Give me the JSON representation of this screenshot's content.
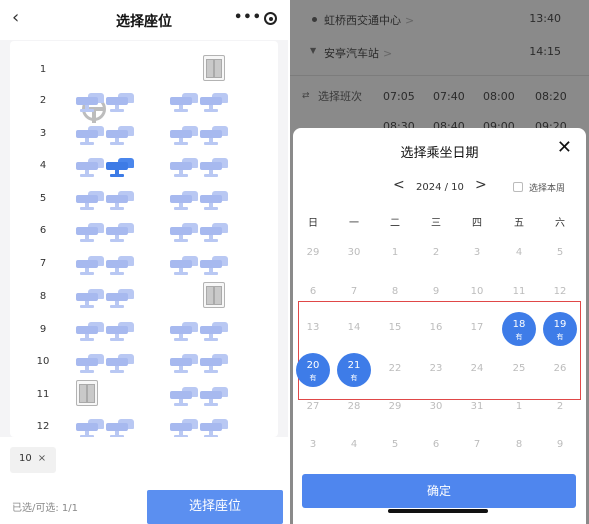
{
  "seat_screen": {
    "back_icon": "chevron-left-icon",
    "title": "选择座位",
    "capsule_more": "•••",
    "capsule_icon": "target-close-icon",
    "rows": [
      "1",
      "2",
      "3",
      "4",
      "5",
      "6",
      "7",
      "8",
      "9",
      "10",
      "11",
      "12"
    ],
    "selected_seat": {
      "row": "4",
      "column": "B"
    },
    "selected_chip": {
      "label": "10",
      "remove": "×"
    },
    "selection_count": "已选/可选: 1/1",
    "choose_button": "选择座位",
    "colors": {
      "seat": "#b9c8f3",
      "seat_selected": "#3d7be6",
      "button": "#5b8ff0"
    }
  },
  "trip_background": {
    "stops": [
      {
        "name": "虹桥西交通中心",
        "chevron": ">",
        "time": "13:40"
      },
      {
        "name": "安亭汽车站",
        "chevron": ">",
        "time": "14:15"
      }
    ],
    "schedule_label": "选择班次",
    "schedule_times": [
      "07:05",
      "07:40",
      "08:00",
      "08:20"
    ],
    "schedule_times_row2": [
      "08:30",
      "08:40",
      "09:00",
      "09:20"
    ]
  },
  "date_picker": {
    "title": "选择乘坐日期",
    "close": "✕",
    "prev": "<",
    "month": "2024 / 10",
    "next": ">",
    "this_week_label": "选择本周",
    "weekdays": [
      "日",
      "一",
      "二",
      "三",
      "四",
      "五",
      "六"
    ],
    "weeks": [
      [
        "29",
        "30",
        "1",
        "2",
        "3",
        "4",
        "5"
      ],
      [
        "6",
        "7",
        "8",
        "9",
        "10",
        "11",
        "12"
      ],
      [
        "13",
        "14",
        "15",
        "16",
        "17",
        "18",
        "19"
      ],
      [
        "20",
        "21",
        "22",
        "23",
        "24",
        "25",
        "26"
      ],
      [
        "27",
        "28",
        "29",
        "30",
        "31",
        "1",
        "2"
      ],
      [
        "3",
        "4",
        "5",
        "6",
        "7",
        "8",
        "9"
      ]
    ],
    "available_days": [
      "18",
      "19",
      "20",
      "21"
    ],
    "available_tag": "有",
    "confirm_button": "确定",
    "colors": {
      "available": "#3e7ce8",
      "highlight_border": "#e04848",
      "confirm": "#4f86ee"
    }
  }
}
